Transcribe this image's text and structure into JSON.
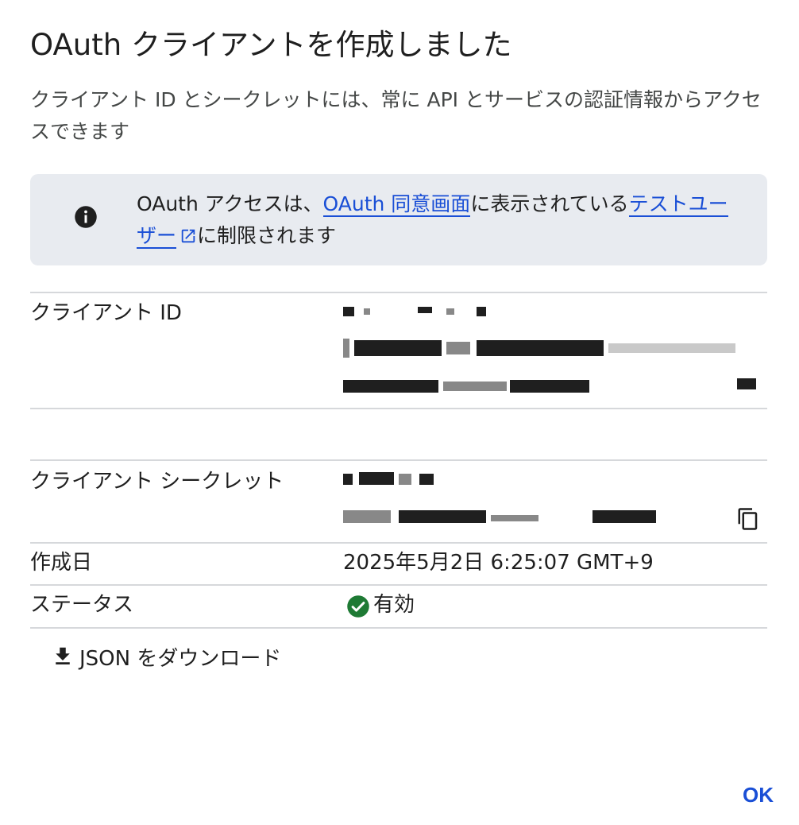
{
  "dialog": {
    "title": "OAuth クライアントを作成しました",
    "subtitle": "クライアント ID とシークレットには、常に API とサービスの認証情報からアクセスできます"
  },
  "banner": {
    "text_before": "OAuth アクセスは、",
    "consent_link": "OAuth 同意画面",
    "text_middle": "に表示されている",
    "test_users_link": "テストユーザー",
    "text_after": "に制限されます",
    "icon": "info-icon"
  },
  "fields": {
    "client_id_label": "クライアント ID",
    "client_secret_label": "クライアント シークレット",
    "created_label": "作成日",
    "created_value": "2025年5月2日 6:25:07 GMT+9",
    "status_label": "ステータス",
    "status_value": "有効"
  },
  "actions": {
    "download_label": "JSON をダウンロード",
    "ok_label": "OK"
  },
  "colors": {
    "link": "#1a4fd6",
    "banner_bg": "#e8ebf0",
    "status_ok": "#1e7a34"
  }
}
